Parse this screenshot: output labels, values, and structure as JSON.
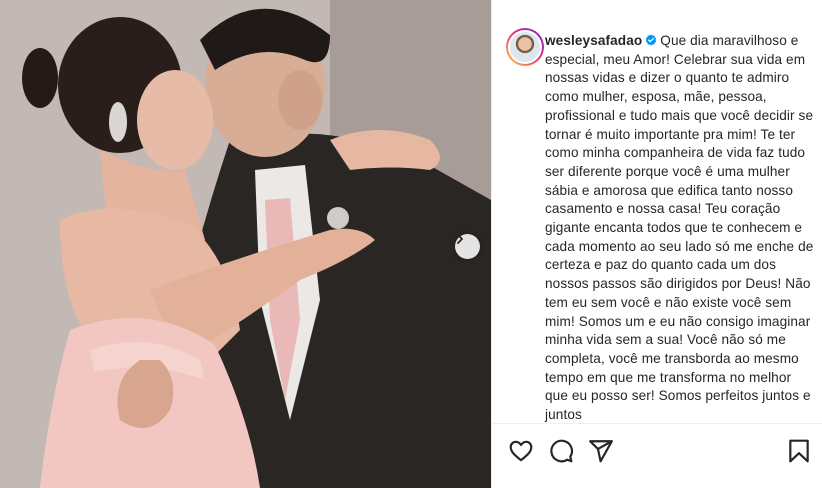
{
  "post": {
    "username": "wesleysafadao",
    "verified": true,
    "caption": "Que dia maravilhoso e especial, meu Amor! Celebrar sua vida em nossas vidas e dizer o quanto te admiro como mulher, esposa, mãe, pessoa, profissional e tudo mais que você decidir se tornar é muito importante pra mim! Te ter como minha companheira de vida faz tudo ser diferente porque você é uma mulher sábia e amorosa que edifica tanto nosso casamento e nossa casa! Teu coração gigante encanta todos que te conhecem e cada momento ao seu lado só me enche de certeza e paz do quanto cada um dos nossos passos são dirigidos por Deus! Não tem eu sem você e não existe você sem mim! Somos um e eu não consigo imaginar minha vida sem a sua! Você não só me completa, você me transborda ao mesmo tempo em que me transforma no melhor que eu posso ser! Somos perfeitos juntos e juntos"
  },
  "icons": {
    "like": "heart-icon",
    "comment": "comment-icon",
    "share": "share-icon",
    "save": "bookmark-icon",
    "next": "chevron-right-icon",
    "verified": "verified-badge-icon"
  },
  "colors": {
    "text": "#262626",
    "verified": "#0095f6",
    "divider": "#efefef"
  }
}
